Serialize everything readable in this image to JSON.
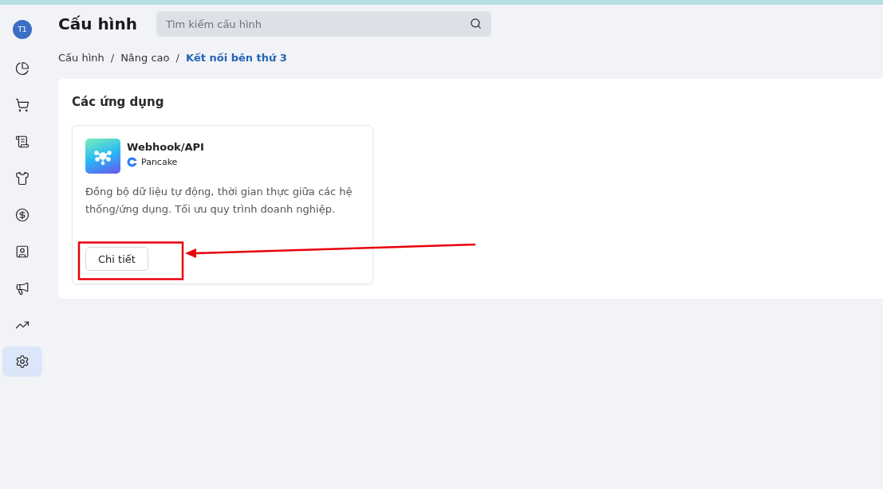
{
  "sidebar": {
    "avatar": "T1",
    "items": [
      {
        "selected": false
      },
      {
        "selected": false
      },
      {
        "selected": false
      },
      {
        "selected": false
      },
      {
        "selected": false
      },
      {
        "selected": false
      },
      {
        "selected": false
      },
      {
        "selected": false
      },
      {
        "selected": true
      }
    ]
  },
  "header": {
    "title": "Cấu hình",
    "search": {
      "placeholder": "Tìm kiếm cấu hình"
    }
  },
  "breadcrumb": [
    {
      "label": "Cấu hình",
      "selected": false
    },
    {
      "label": "Nâng cao",
      "selected": false
    },
    {
      "label": "Kết nối bên thứ 3",
      "selected": true
    }
  ],
  "breadcrumb_separators": [
    "/",
    "/"
  ],
  "section": {
    "title": "Các ứng dụng",
    "apps": [
      {
        "name": "Webhook/API",
        "provider": "Pancake",
        "description": "Đồng bộ dữ liệu tự động, thời gian thực giữa các hệ thống/ứng dụng. Tối ưu quy trình doanh nghiệp.",
        "button": "Chi tiết"
      }
    ]
  }
}
